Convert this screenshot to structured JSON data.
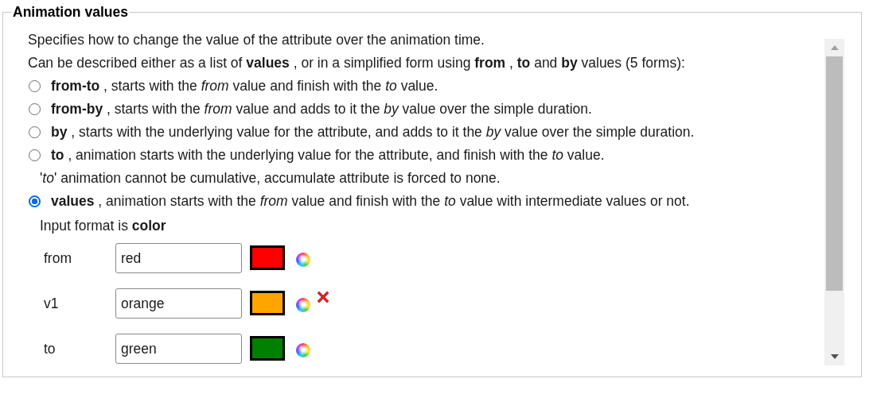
{
  "panel": {
    "title": "Animation values",
    "intro": [
      "Specifies how to change the value of the attribute over the animation time.",
      "Can be described either as a list of **values** , or in a simplified form using **from** , **to** and **by** values (5 forms):"
    ],
    "options": [
      {
        "kind": "radio",
        "text": "**from-to** , starts with the *from* value and finish with the *to* value.",
        "selected": false
      },
      {
        "kind": "radio",
        "text": "**from-by** , starts with the *from* value and adds to it the *by* value over the simple duration.",
        "selected": false
      },
      {
        "kind": "radio",
        "text": "**by** , starts with the underlying value for the attribute, and adds to it the *by* value over the simple duration.",
        "selected": false
      },
      {
        "kind": "radio",
        "text": "**to** , animation starts with the underlying value for the attribute, and finish with the *to* value.",
        "selected": false
      },
      {
        "kind": "note",
        "text": "'*to*' animation cannot be cumulative, accumulate attribute is forced to none."
      },
      {
        "kind": "radio",
        "text": "**values** , animation starts with the *from* value and finish with the *to* value with intermediate values or not.",
        "selected": true
      }
    ],
    "format": "Input format is **color**",
    "values": [
      {
        "label": "from",
        "value": "red",
        "color": "#ff0000",
        "deletable": false
      },
      {
        "label": "v1",
        "value": "orange",
        "color": "#ffa500",
        "deletable": true
      },
      {
        "label": "to",
        "value": "green",
        "color": "#008000",
        "deletable": false
      }
    ]
  }
}
